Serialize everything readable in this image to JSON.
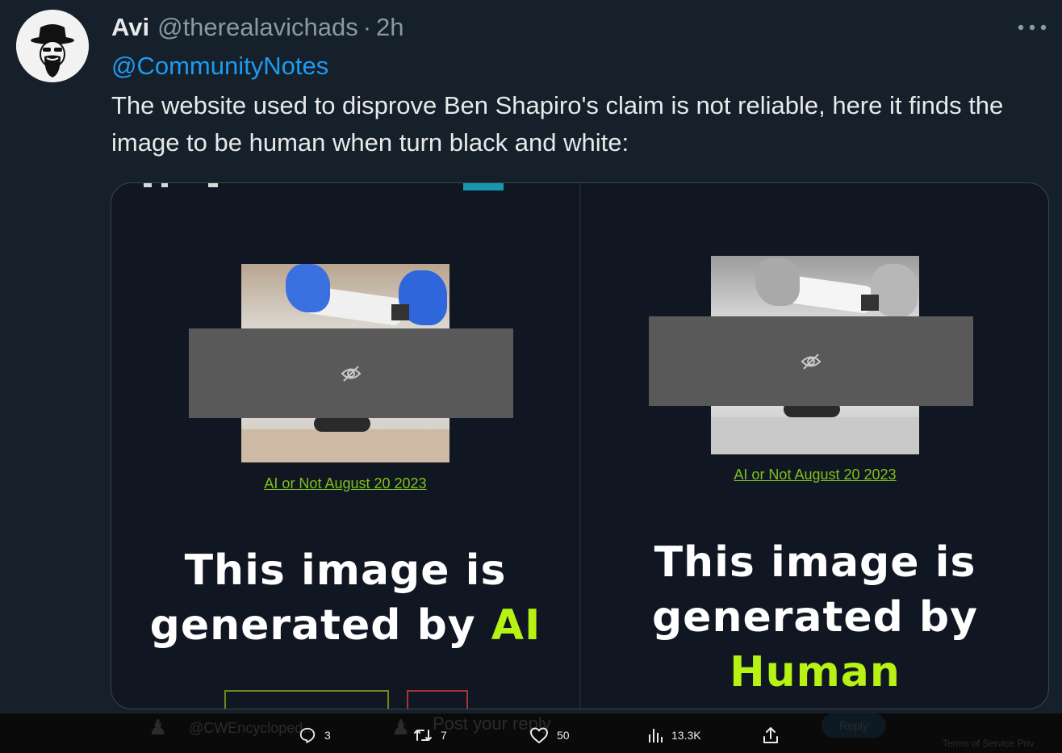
{
  "tweet": {
    "display_name": "Avi",
    "handle": "@therealavichads",
    "separator": "·",
    "time": "2h",
    "mention": "@CommunityNotes",
    "text": "The website used to disprove Ben Shapiro's claim is not reliable, here it finds the image to be human when turn black and white:"
  },
  "media": {
    "left_panel": {
      "source_link": "AI or Not August 20 2023",
      "verdict_line1": "This image is",
      "verdict_line2_prefix": "generated by ",
      "verdict_accent": "AI"
    },
    "right_panel": {
      "source_link": "AI or Not August 20 2023",
      "verdict_line1": "This image is",
      "verdict_line2": "generated by",
      "verdict_accent": "Human"
    }
  },
  "actions": {
    "replies": "3",
    "retweets": "7",
    "likes": "50",
    "views": "13.3K"
  },
  "background_ghost": {
    "handle_fragment": "@CWEncycloped...",
    "reply_prompt": "Post your reply",
    "reply_button": "Reply",
    "footer_fragment": "Terms of Service   Priv"
  },
  "colors": {
    "background": "#15202b",
    "link_blue": "#1d9bf0",
    "accent_green": "#b6f214",
    "hidden_overlay": "#595959"
  },
  "icons": [
    "ellipsis-icon",
    "hidden-eye-icon",
    "reply-icon",
    "retweet-icon",
    "like-icon",
    "views-icon",
    "share-icon"
  ]
}
